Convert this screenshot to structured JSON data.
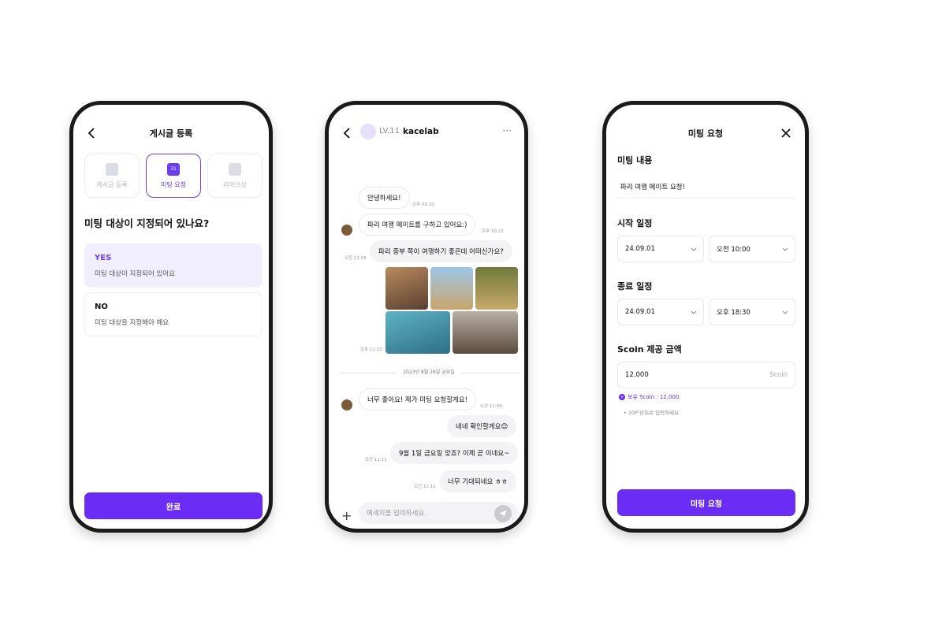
{
  "screen1": {
    "title": "게시글 등록",
    "tabs": [
      {
        "label": "게시글 등록"
      },
      {
        "label": "미팅 요청",
        "icon_text": "31"
      },
      {
        "label": "라이브샷"
      }
    ],
    "question": "미팅 대상이 지정되어 있나요?",
    "options": [
      {
        "title": "YES",
        "desc": "미팅 대상이 지정되어 있어요"
      },
      {
        "title": "NO",
        "desc": "미팅 대상을 지정해야 해요"
      }
    ],
    "done_button": "완료",
    "accent": "#6b2cf5"
  },
  "screen2": {
    "level": "LV.11",
    "username": "kacelab",
    "more": "···",
    "messages": [
      {
        "text": "안녕하세요!",
        "time": "오후 09:20"
      },
      {
        "text": "파리 여행 메이트를 구하고 있어요:)",
        "time": "오후 10:22"
      },
      {
        "text": "파리 중부 쪽이 여행하기 좋은데 어떠신가요?",
        "time": "오전 12:09"
      },
      {
        "text": "",
        "time": "오후 11:23"
      },
      {
        "text": "너무 좋아요! 제가 미팅 요청할게요!",
        "time": "오전 12:09"
      },
      {
        "text": "네네 확인할게요😊",
        "time": ""
      },
      {
        "text": "9월 1일 금요일 맞죠? 이제 곧 이네요~",
        "time": "오전 12:11"
      },
      {
        "text": "너무 기대되네요 ㅎㅎ",
        "time": "오전 12:12"
      }
    ],
    "date_divider": "2023년 8월 26일 금요일",
    "input_placeholder": "메세지를 입력하세요."
  },
  "screen3": {
    "title": "미팅 요청",
    "content_label": "미팅 내용",
    "content_value": "파리 여행 메이트 요청!",
    "start_label": "시작 일정",
    "start_date": "24.09.01",
    "start_time": "오전 10:00",
    "end_label": "종료 일정",
    "end_date": "24.09.01",
    "end_time": "오후 18:30",
    "scoin_label": "Scoin 제공 금액",
    "scoin_value": "12,000",
    "scoin_unit": "Scoin",
    "owned": "보유 Scoin : 12,000",
    "owned_icon": "+",
    "hint": "•  10P 단위로 입력하세요.",
    "submit": "미팅 요청"
  }
}
